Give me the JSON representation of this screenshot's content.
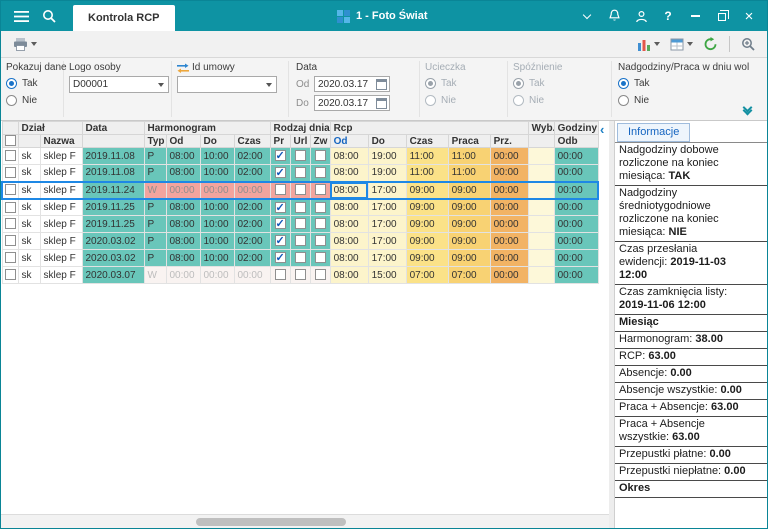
{
  "colors": {
    "teal": "#0e93a3",
    "sel_blue": "#1e88e5",
    "cell_teal": "#69c6ba",
    "cell_pink": "#f2a49e",
    "cell_free": "#f9f3f1",
    "y_light": "#fcf4cb",
    "y_mid": "#fbe288",
    "y_amber": "#f8d273",
    "y_orange": "#f2b364",
    "cream": "#fdf8d9"
  },
  "icons": {
    "close": "×",
    "help": "?",
    "collapse_left": "‹"
  },
  "topbar": {
    "tab": "Kontrola RCP",
    "company": "1 - Foto Świat"
  },
  "toolbar": {
    "buttons": [
      "print",
      "chart",
      "layout",
      "refresh",
      "zoom"
    ]
  },
  "filters": {
    "pokazuj_dane": {
      "label": "Pokazuj dane",
      "tak": "Tak",
      "nie": "Nie",
      "selected": "Tak"
    },
    "logo_osoby": {
      "label": "Logo osoby",
      "value": "D00001"
    },
    "id_umowy": {
      "label": "Id umowy",
      "value": ""
    },
    "data": {
      "label": "Data",
      "od_label": "Od",
      "do_label": "Do",
      "od": "2020.03.17",
      "do": "2020.03.17"
    },
    "ucieczka": {
      "label": "Ucieczka",
      "tak": "Tak",
      "nie": "Nie",
      "selected": "Tak",
      "enabled": false
    },
    "spoznienie": {
      "label": "Spóźnienie",
      "tak": "Tak",
      "nie": "Nie",
      "selected": "Tak",
      "enabled": false
    },
    "nadgodziny": {
      "label": "Nadgodziny/Praca w dniu wol",
      "tak": "Tak",
      "nie": "Nie",
      "selected": "Tak",
      "enabled": true
    }
  },
  "table": {
    "groups": {
      "dzial": "Dział",
      "data": "Data",
      "harmonogram": "Harmonogram",
      "rodzaj_dnia": "Rodzaj dnia",
      "rcp": "Rcp",
      "wyb": "Wyb.",
      "godziny": "Godziny i"
    },
    "subheaders": {
      "nazwa": "Nazwa",
      "typ": "Typ",
      "od": "Od",
      "do": "Do",
      "czas": "Czas",
      "pr": "Pr",
      "url": "Url",
      "zw": "Zw",
      "od2": "Od",
      "do2": "Do",
      "czas2": "Czas",
      "praca": "Praca",
      "prz": "Prz.",
      "odb": "Odb"
    },
    "rows": [
      {
        "dzial": "sk",
        "nazwa": "sklep F",
        "data": "2019.11.08",
        "typ": "P",
        "h_od": "08:00",
        "h_do": "10:00",
        "h_czas": "02:00",
        "pr": true,
        "url": false,
        "zw": false,
        "rcp_od": "08:00",
        "rcp_do": "19:00",
        "rcp_czas": "11:00",
        "praca": "11:00",
        "prz": "00:00",
        "wyb": "",
        "odb": "00:00",
        "day": "work",
        "selected": false
      },
      {
        "dzial": "sk",
        "nazwa": "sklep F",
        "data": "2019.11.08",
        "typ": "P",
        "h_od": "08:00",
        "h_do": "10:00",
        "h_czas": "02:00",
        "pr": true,
        "url": false,
        "zw": false,
        "rcp_od": "08:00",
        "rcp_do": "19:00",
        "rcp_czas": "11:00",
        "praca": "11:00",
        "prz": "00:00",
        "wyb": "",
        "odb": "00:00",
        "day": "work",
        "selected": false
      },
      {
        "dzial": "sk",
        "nazwa": "sklep F",
        "data": "2019.11.24",
        "typ": "W",
        "h_od": "00:00",
        "h_do": "00:00",
        "h_czas": "00:00",
        "pr": false,
        "url": false,
        "zw": false,
        "rcp_od": "08:00",
        "rcp_do": "17:00",
        "rcp_czas": "09:00",
        "praca": "09:00",
        "prz": "00:00",
        "wyb": "",
        "odb": "00:00",
        "day": "flag",
        "selected": true,
        "focus_col": "rod"
      },
      {
        "dzial": "sk",
        "nazwa": "sklep F",
        "data": "2019.11.25",
        "typ": "P",
        "h_od": "08:00",
        "h_do": "10:00",
        "h_czas": "02:00",
        "pr": true,
        "url": false,
        "zw": false,
        "rcp_od": "08:00",
        "rcp_do": "17:00",
        "rcp_czas": "09:00",
        "praca": "09:00",
        "prz": "00:00",
        "wyb": "",
        "odb": "00:00",
        "day": "work",
        "selected": false
      },
      {
        "dzial": "sk",
        "nazwa": "sklep F",
        "data": "2019.11.25",
        "typ": "P",
        "h_od": "08:00",
        "h_do": "10:00",
        "h_czas": "02:00",
        "pr": true,
        "url": false,
        "zw": false,
        "rcp_od": "08:00",
        "rcp_do": "17:00",
        "rcp_czas": "09:00",
        "praca": "09:00",
        "prz": "00:00",
        "wyb": "",
        "odb": "00:00",
        "day": "work",
        "selected": false
      },
      {
        "dzial": "sk",
        "nazwa": "sklep F",
        "data": "2020.03.02",
        "typ": "P",
        "h_od": "08:00",
        "h_do": "10:00",
        "h_czas": "02:00",
        "pr": true,
        "url": false,
        "zw": false,
        "rcp_od": "08:00",
        "rcp_do": "17:00",
        "rcp_czas": "09:00",
        "praca": "09:00",
        "prz": "00:00",
        "wyb": "",
        "odb": "00:00",
        "day": "work",
        "selected": false
      },
      {
        "dzial": "sk",
        "nazwa": "sklep F",
        "data": "2020.03.02",
        "typ": "P",
        "h_od": "08:00",
        "h_do": "10:00",
        "h_czas": "02:00",
        "pr": true,
        "url": false,
        "zw": false,
        "rcp_od": "08:00",
        "rcp_do": "17:00",
        "rcp_czas": "09:00",
        "praca": "09:00",
        "prz": "00:00",
        "wyb": "",
        "odb": "00:00",
        "day": "work",
        "selected": false
      },
      {
        "dzial": "sk",
        "nazwa": "sklep F",
        "data": "2020.03.07",
        "typ": "W",
        "h_od": "00:00",
        "h_do": "00:00",
        "h_czas": "00:00",
        "pr": false,
        "url": false,
        "zw": false,
        "rcp_od": "08:00",
        "rcp_do": "15:00",
        "rcp_czas": "07:00",
        "praca": "07:00",
        "prz": "00:00",
        "wyb": "",
        "odb": "00:00",
        "day": "free",
        "selected": false
      }
    ]
  },
  "info_panel": {
    "tab": "Informacje",
    "items": [
      {
        "label": "Nadgodziny dobowe rozliczone na koniec miesiąca:",
        "value": "TAK",
        "bold": true
      },
      {
        "label": "Nadgodziny średniotygodniowe rozliczone na koniec miesiąca:",
        "value": "NIE",
        "bold": true
      },
      {
        "label": "Czas przesłania ewidencji:",
        "value": "2019-11-03 12:00",
        "bold": true
      },
      {
        "label": "Czas zamknięcia listy:",
        "value": "2019-11-06 12:00",
        "bold": true
      },
      {
        "label": "Miesiąc",
        "value": "",
        "header": true
      },
      {
        "label": "Harmonogram:",
        "value": "38.00",
        "bold": true
      },
      {
        "label": "RCP:",
        "value": "63.00",
        "bold": true
      },
      {
        "label": "Absencje:",
        "value": "0.00",
        "bold": true
      },
      {
        "label": "Absencje wszystkie:",
        "value": "0.00",
        "bold": true
      },
      {
        "label": "Praca + Absencje:",
        "value": "63.00",
        "bold": true
      },
      {
        "label": "Praca + Absencje wszystkie:",
        "value": "63.00",
        "bold": true
      },
      {
        "label": "Przepustki płatne:",
        "value": "0.00",
        "bold": true
      },
      {
        "label": "Przepustki niepłatne:",
        "value": "0.00",
        "bold": true
      },
      {
        "label": "Okres",
        "value": "",
        "header": true
      }
    ]
  }
}
